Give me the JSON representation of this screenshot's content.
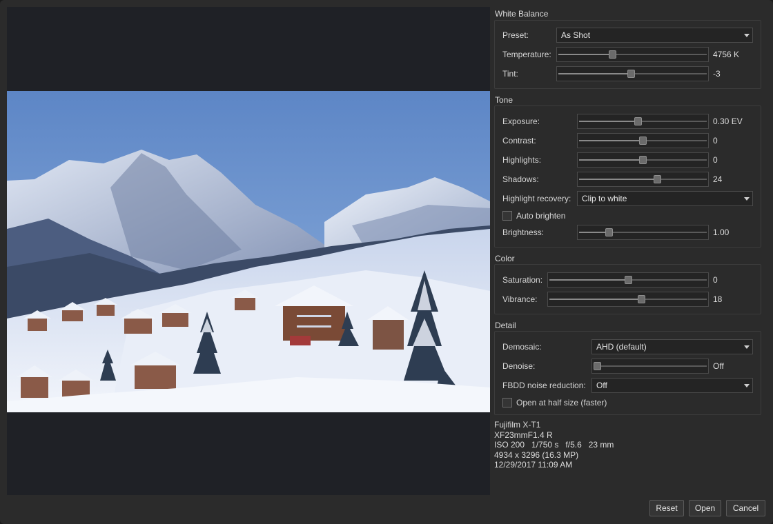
{
  "white_balance": {
    "title": "White Balance",
    "preset_label": "Preset:",
    "preset_value": "As Shot",
    "temperature_label": "Temperature:",
    "temperature_value": "4756 K",
    "temperature_level": 0.36,
    "tint_label": "Tint:",
    "tint_value": "-3",
    "tint_level": 0.49
  },
  "tone": {
    "title": "Tone",
    "exposure_label": "Exposure:",
    "exposure_value": "0.30 EV",
    "exposure_level": 0.46,
    "contrast_label": "Contrast:",
    "contrast_value": "0",
    "contrast_level": 0.5,
    "highlights_label": "Highlights:",
    "highlights_value": "0",
    "highlights_level": 0.5,
    "shadows_label": "Shadows:",
    "shadows_value": "24",
    "shadows_level": 0.62,
    "highlight_recovery_label": "Highlight recovery:",
    "highlight_recovery_value": "Clip to white",
    "auto_brighten_label": "Auto brighten",
    "auto_brighten_checked": false,
    "brightness_label": "Brightness:",
    "brightness_value": "1.00",
    "brightness_level": 0.22
  },
  "color": {
    "title": "Color",
    "saturation_label": "Saturation:",
    "saturation_value": "0",
    "saturation_level": 0.5,
    "vibrance_label": "Vibrance:",
    "vibrance_value": "18",
    "vibrance_level": 0.59
  },
  "detail": {
    "title": "Detail",
    "demosaic_label": "Demosaic:",
    "demosaic_value": "AHD (default)",
    "denoise_label": "Denoise:",
    "denoise_value": "Off",
    "denoise_level": 0.0,
    "fbdd_label": "FBDD noise reduction:",
    "fbdd_value": "Off",
    "half_size_label": "Open at half size (faster)",
    "half_size_checked": false
  },
  "info": {
    "camera": "Fujifilm X-T1",
    "lens": "XF23mmF1.4 R",
    "exposure": "ISO 200   1/750 s   f/5.6   23 mm",
    "dimensions": "4934 x 3296 (16.3 MP)",
    "date": "12/29/2017 11:09 AM"
  },
  "buttons": {
    "reset": "Reset",
    "open": "Open",
    "cancel": "Cancel"
  },
  "colors": {
    "sky_top": "#5b84c4",
    "sky_bottom": "#8fb0dc",
    "snow": "#e6ecf7",
    "mountain_shadow": "#4a5a7a"
  }
}
